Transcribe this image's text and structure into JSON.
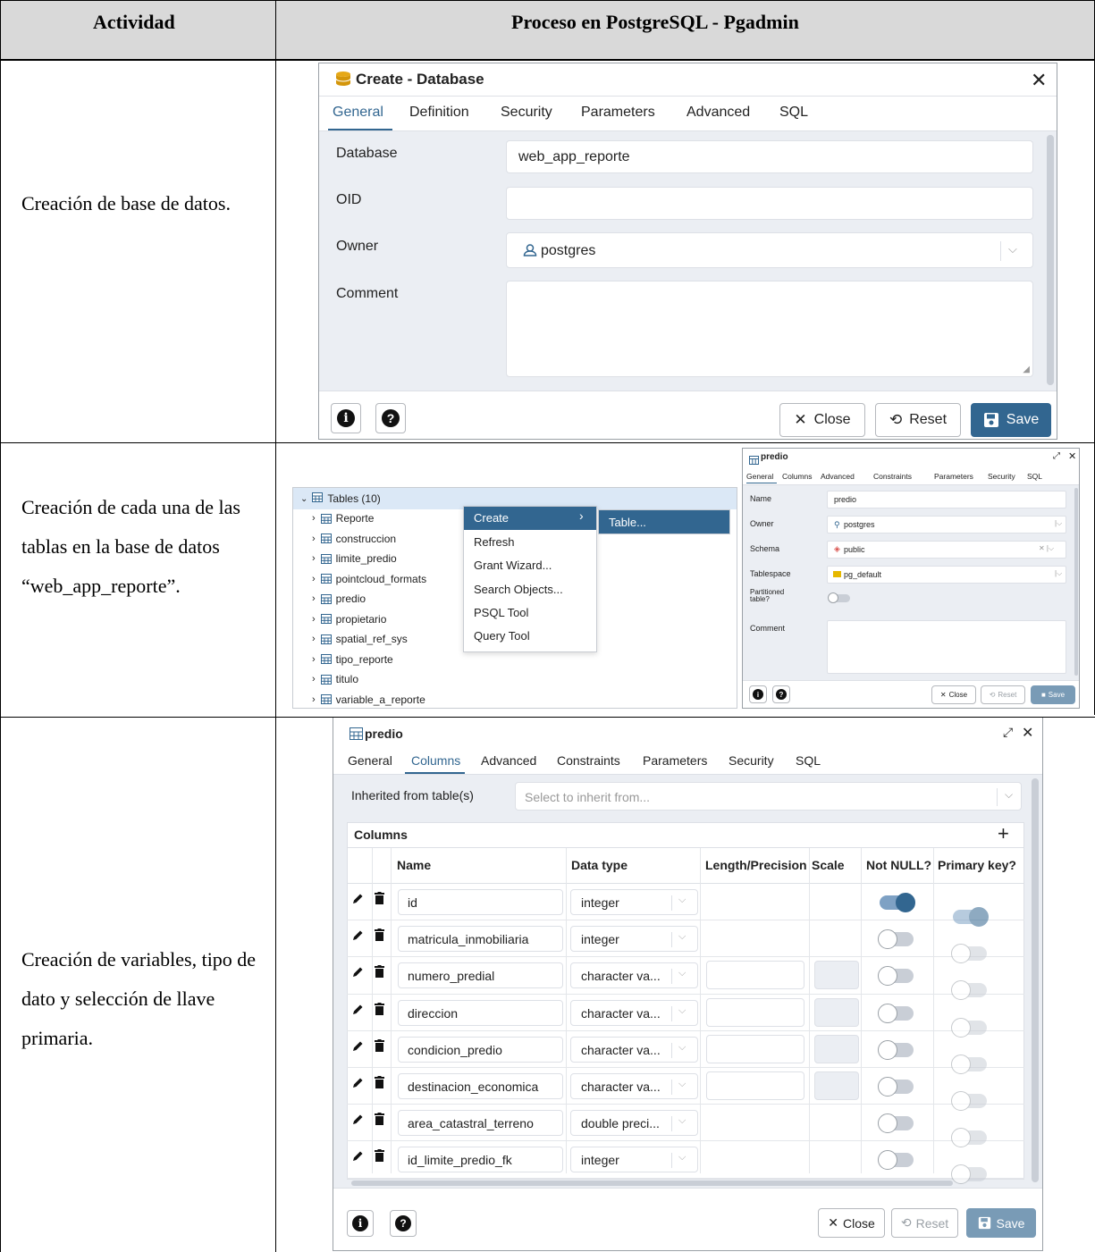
{
  "table": {
    "header": {
      "col1": "Actividad",
      "col2": "Proceso en PostgreSQL - Pgadmin"
    },
    "rows": [
      {
        "activity": "Creación de base de datos."
      },
      {
        "activity": "Creación de cada una de las tablas en la base de datos “web_app_reporte”."
      },
      {
        "activity": "Creación de variables, tipo de dato y selección de llave primaria."
      }
    ]
  },
  "db_dialog": {
    "title": "Create - Database",
    "tabs": [
      "General",
      "Definition",
      "Security",
      "Parameters",
      "Advanced",
      "SQL"
    ],
    "active_tab": "General",
    "fields": {
      "database_label": "Database",
      "database_value": "web_app_reporte",
      "oid_label": "OID",
      "oid_value": "",
      "owner_label": "Owner",
      "owner_value": "postgres",
      "comment_label": "Comment",
      "comment_value": ""
    },
    "buttons": {
      "close": "Close",
      "reset": "Reset",
      "save": "Save"
    }
  },
  "tree": {
    "root": "Tables (10)",
    "items": [
      "Reporte",
      "construccion",
      "limite_predio",
      "pointcloud_formats",
      "predio",
      "propietario",
      "spatial_ref_sys",
      "tipo_reporte",
      "titulo",
      "variable_a_reporte"
    ]
  },
  "context_menu": {
    "items": [
      "Create",
      "Refresh",
      "Grant Wizard...",
      "Search Objects...",
      "PSQL Tool",
      "Query Tool"
    ],
    "submenu": "Table..."
  },
  "table_dialog_small": {
    "title": "predio",
    "tabs": [
      "General",
      "Columns",
      "Advanced",
      "Constraints",
      "Parameters",
      "Security",
      "SQL"
    ],
    "fields": {
      "name_label": "Name",
      "name_value": "predio",
      "owner_label": "Owner",
      "owner_value": "postgres",
      "schema_label": "Schema",
      "schema_value": "public",
      "tablespace_label": "Tablespace",
      "tablespace_value": "pg_default",
      "partitioned_label_1": "Partitioned",
      "partitioned_label_2": "table?",
      "comment_label": "Comment"
    },
    "buttons": {
      "close": "Close",
      "reset": "Reset",
      "save": "Save"
    }
  },
  "columns_dialog": {
    "title": "predio",
    "tabs": [
      "General",
      "Columns",
      "Advanced",
      "Constraints",
      "Parameters",
      "Security",
      "SQL"
    ],
    "active_tab": "Columns",
    "inherited_label": "Inherited from table(s)",
    "inherited_placeholder": "Select to inherit from...",
    "columns_title": "Columns",
    "headers": {
      "name": "Name",
      "type": "Data type",
      "length": "Length/Precision",
      "scale": "Scale",
      "notnull": "Not NULL?",
      "pk": "Primary key?"
    },
    "rows": [
      {
        "name": "id",
        "type": "integer",
        "notnull": true,
        "pk": true,
        "length_field": false
      },
      {
        "name": "matricula_inmobiliaria",
        "type": "integer",
        "notnull": false,
        "pk": false,
        "length_field": false
      },
      {
        "name": "numero_predial",
        "type": "character va...",
        "notnull": false,
        "pk": false,
        "length_field": true
      },
      {
        "name": "direccion",
        "type": "character va...",
        "notnull": false,
        "pk": false,
        "length_field": true
      },
      {
        "name": "condicion_predio",
        "type": "character va...",
        "notnull": false,
        "pk": false,
        "length_field": true
      },
      {
        "name": "destinacion_economica",
        "type": "character va...",
        "notnull": false,
        "pk": false,
        "length_field": true
      },
      {
        "name": "area_catastral_terreno",
        "type": "double preci...",
        "notnull": false,
        "pk": false,
        "length_field": false
      },
      {
        "name": "id_limite_predio_fk",
        "type": "integer",
        "notnull": false,
        "pk": false,
        "length_field": false
      }
    ],
    "buttons": {
      "close": "Close",
      "reset": "Reset",
      "save": "Save"
    }
  }
}
